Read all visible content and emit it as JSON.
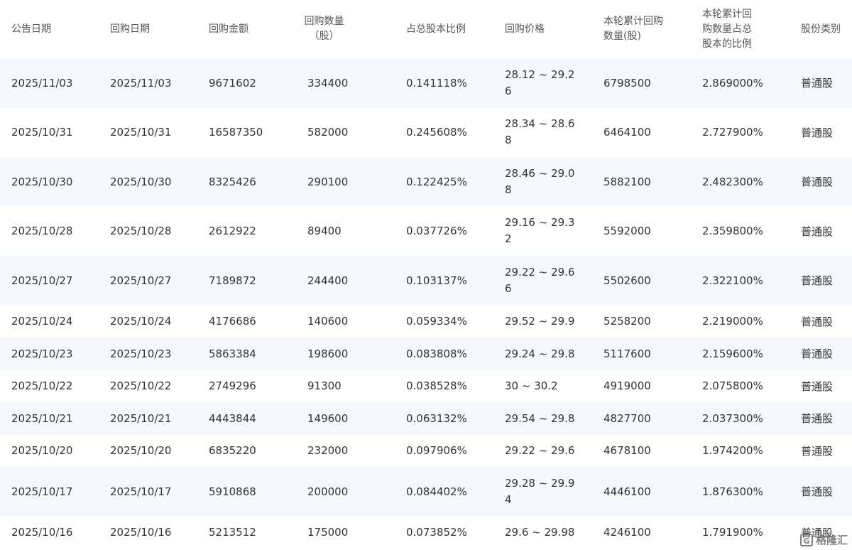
{
  "columns": [
    "公告日期",
    "回购日期",
    "回购金额",
    "回购数量（股）",
    "占总股本比例",
    "回购价格",
    "本轮累计回购数量(股)",
    "本轮累计回购数量占总股本的比例",
    "股份类别"
  ],
  "rows": [
    {
      "announce_date": "2025/11/03",
      "buyback_date": "2025/11/03",
      "amount": "9671602",
      "quantity": "334400",
      "ratio": "0.141118%",
      "price": "28.12 ~ 29.26",
      "cumulative_qty": "6798500",
      "cumulative_ratio": "2.869000%",
      "share_type": "普通股"
    },
    {
      "announce_date": "2025/10/31",
      "buyback_date": "2025/10/31",
      "amount": "16587350",
      "quantity": "582000",
      "ratio": "0.245608%",
      "price": "28.34 ~ 28.68",
      "cumulative_qty": "6464100",
      "cumulative_ratio": "2.727900%",
      "share_type": "普通股"
    },
    {
      "announce_date": "2025/10/30",
      "buyback_date": "2025/10/30",
      "amount": "8325426",
      "quantity": "290100",
      "ratio": "0.122425%",
      "price": "28.46 ~ 29.08",
      "cumulative_qty": "5882100",
      "cumulative_ratio": "2.482300%",
      "share_type": "普通股"
    },
    {
      "announce_date": "2025/10/28",
      "buyback_date": "2025/10/28",
      "amount": "2612922",
      "quantity": "89400",
      "ratio": "0.037726%",
      "price": "29.16 ~ 29.32",
      "cumulative_qty": "5592000",
      "cumulative_ratio": "2.359800%",
      "share_type": "普通股"
    },
    {
      "announce_date": "2025/10/27",
      "buyback_date": "2025/10/27",
      "amount": "7189872",
      "quantity": "244400",
      "ratio": "0.103137%",
      "price": "29.22 ~ 29.66",
      "cumulative_qty": "5502600",
      "cumulative_ratio": "2.322100%",
      "share_type": "普通股"
    },
    {
      "announce_date": "2025/10/24",
      "buyback_date": "2025/10/24",
      "amount": "4176686",
      "quantity": "140600",
      "ratio": "0.059334%",
      "price": "29.52 ~ 29.9",
      "cumulative_qty": "5258200",
      "cumulative_ratio": "2.219000%",
      "share_type": "普通股"
    },
    {
      "announce_date": "2025/10/23",
      "buyback_date": "2025/10/23",
      "amount": "5863384",
      "quantity": "198600",
      "ratio": "0.083808%",
      "price": "29.24 ~ 29.8",
      "cumulative_qty": "5117600",
      "cumulative_ratio": "2.159600%",
      "share_type": "普通股"
    },
    {
      "announce_date": "2025/10/22",
      "buyback_date": "2025/10/22",
      "amount": "2749296",
      "quantity": "91300",
      "ratio": "0.038528%",
      "price": "30 ~ 30.2",
      "cumulative_qty": "4919000",
      "cumulative_ratio": "2.075800%",
      "share_type": "普通股"
    },
    {
      "announce_date": "2025/10/21",
      "buyback_date": "2025/10/21",
      "amount": "4443844",
      "quantity": "149600",
      "ratio": "0.063132%",
      "price": "29.54 ~ 29.8",
      "cumulative_qty": "4827700",
      "cumulative_ratio": "2.037300%",
      "share_type": "普通股"
    },
    {
      "announce_date": "2025/10/20",
      "buyback_date": "2025/10/20",
      "amount": "6835220",
      "quantity": "232000",
      "ratio": "0.097906%",
      "price": "29.22 ~ 29.6",
      "cumulative_qty": "4678100",
      "cumulative_ratio": "1.974200%",
      "share_type": "普通股"
    },
    {
      "announce_date": "2025/10/17",
      "buyback_date": "2025/10/17",
      "amount": "5910868",
      "quantity": "200000",
      "ratio": "0.084402%",
      "price": "29.28 ~ 29.94",
      "cumulative_qty": "4446100",
      "cumulative_ratio": "1.876300%",
      "share_type": "普通股"
    },
    {
      "announce_date": "2025/10/16",
      "buyback_date": "2025/10/16",
      "amount": "5213512",
      "quantity": "175000",
      "ratio": "0.073852%",
      "price": "29.6 ~ 29.98",
      "cumulative_qty": "4246100",
      "cumulative_ratio": "1.791900%",
      "share_type": "普通股"
    }
  ],
  "watermark": {
    "logo_text": "G",
    "text": "格隆汇"
  }
}
